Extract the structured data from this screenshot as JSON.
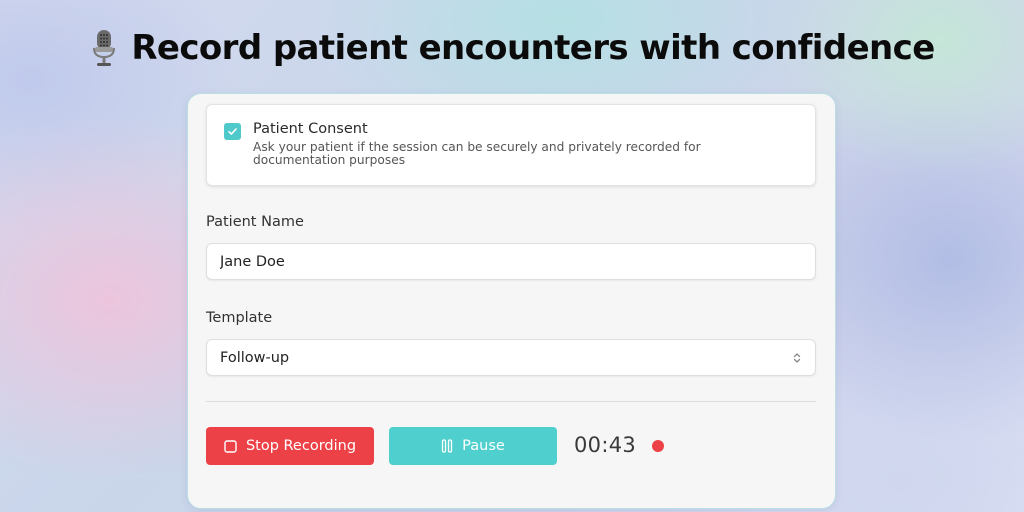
{
  "header": {
    "icon": "microphone-icon",
    "title": "Record patient encounters with confidence"
  },
  "consent": {
    "checked": true,
    "title": "Patient Consent",
    "description": "Ask your patient if the session can be securely and privately recorded for documentation purposes"
  },
  "patient_name": {
    "label": "Patient Name",
    "value": "Jane Doe"
  },
  "template": {
    "label": "Template",
    "selected": "Follow-up"
  },
  "controls": {
    "stop_label": "Stop Recording",
    "pause_label": "Pause",
    "timer": "00:43",
    "recording": true
  },
  "colors": {
    "accent": "#4fcfcd",
    "danger": "#ec4146",
    "card_background": "#f6f6f6"
  }
}
